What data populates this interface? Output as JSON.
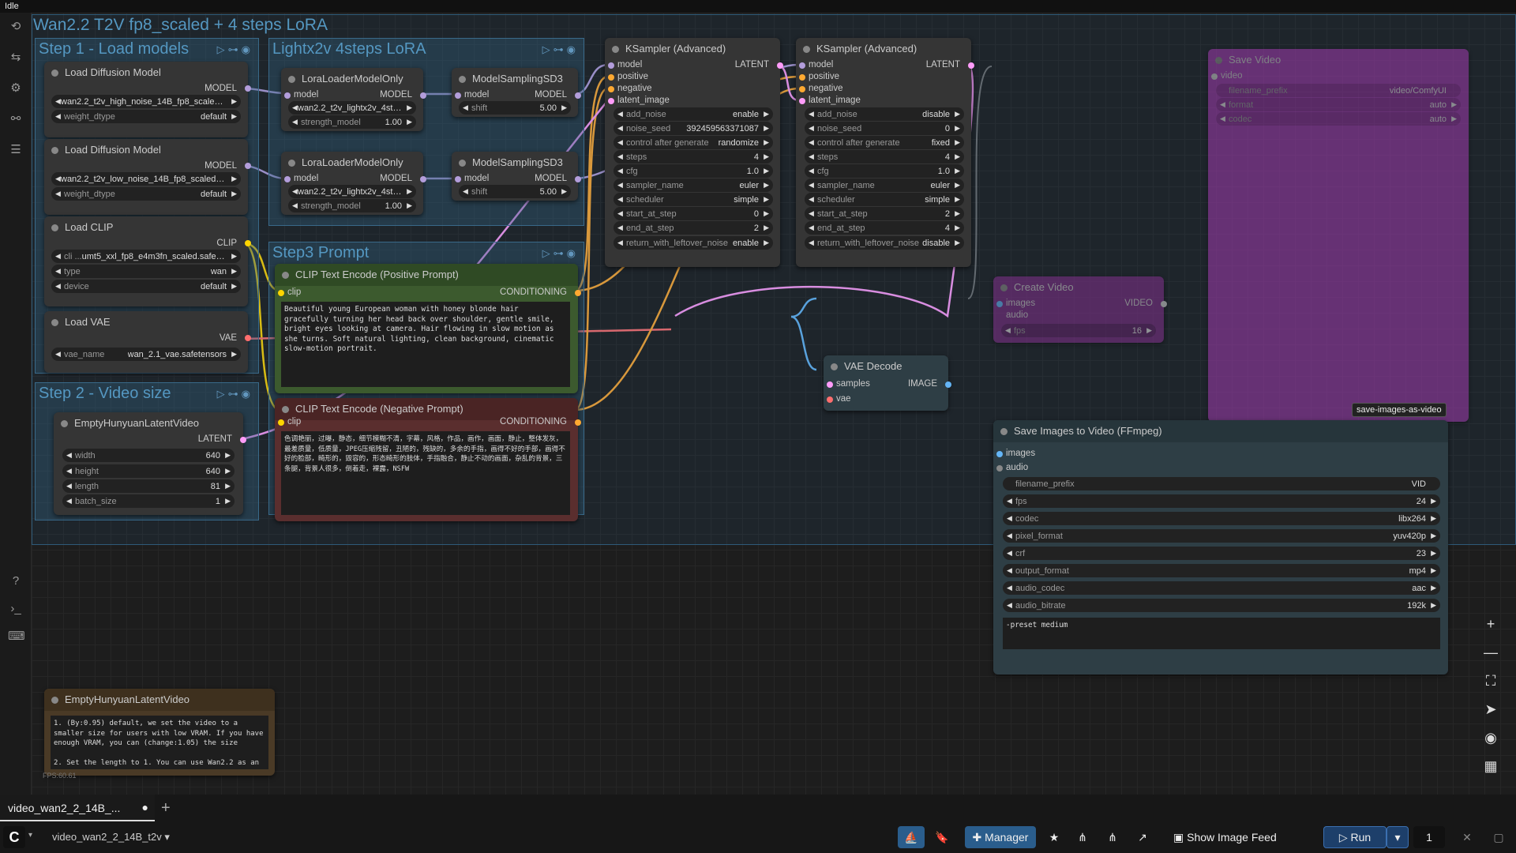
{
  "app": {
    "status": "Idle",
    "fps_readout": "FPS:60.61"
  },
  "workflow_title": "Wan2.2 T2V fp8_scaled +  4 steps LoRA",
  "groups": {
    "step1": "Step 1 - Load models",
    "lightx": "Lightx2v 4steps LoRA",
    "step3": "Step3 Prompt",
    "step2": "Step 2 - Video size"
  },
  "nodes": {
    "diff_high": {
      "title": "Load Diffusion Model",
      "out": "MODEL",
      "unet": "wan2.2_t2v_high_noise_14B_fp8_scaled.saf ...",
      "dtype_label": "weight_dtype",
      "dtype": "default"
    },
    "diff_low": {
      "title": "Load Diffusion Model",
      "out": "MODEL",
      "unet": "wan2.2_t2v_low_noise_14B_fp8_scaled.safet...",
      "dtype_label": "weight_dtype",
      "dtype": "default"
    },
    "clip": {
      "title": "Load CLIP",
      "out": "CLIP",
      "name_label": "cli ...",
      "name": "umt5_xxl_fp8_e4m3fn_scaled.safetensors",
      "type_label": "type",
      "type": "wan",
      "device_label": "device",
      "device": "default"
    },
    "vae": {
      "title": "Load VAE",
      "out": "VAE",
      "name_label": "vae_name",
      "name": "wan_2.1_vae.safetensors"
    },
    "lora1": {
      "title": "LoraLoaderModelOnly",
      "in": "model",
      "out": "MODEL",
      "lora": "wan2.2_t2v_lightx2v_4steps_lora ...",
      "strength_label": "strength_model",
      "strength": "1.00"
    },
    "lora2": {
      "title": "LoraLoaderModelOnly",
      "in": "model",
      "out": "MODEL",
      "lora": "wan2.2_t2v_lightx2v_4steps_lora ...",
      "strength_label": "strength_model",
      "strength": "1.00"
    },
    "msd1": {
      "title": "ModelSamplingSD3",
      "in": "model",
      "out": "MODEL",
      "shift_label": "shift",
      "shift": "5.00"
    },
    "msd2": {
      "title": "ModelSamplingSD3",
      "in": "model",
      "out": "MODEL",
      "shift_label": "shift",
      "shift": "5.00"
    },
    "pos": {
      "title": "CLIP Text Encode (Positive Prompt)",
      "in": "clip",
      "out": "CONDITIONING",
      "text": "Beautiful young European woman with honey blonde hair gracefully turning her head back over shoulder, gentle smile, bright eyes looking at camera. Hair flowing in slow motion as she turns. Soft natural lighting, clean background, cinematic slow-motion portrait."
    },
    "neg": {
      "title": "CLIP Text Encode (Negative Prompt)",
      "in": "clip",
      "out": "CONDITIONING",
      "text": "色调艳丽，过曝，静态，细节模糊不清，字幕，风格，作品，画作，画面，静止，整体发灰，最差质量，低质量，JPEG压缩残留，丑陋的，残缺的，多余的手指，画得不好的手部，画得不好的脸部，畸形的，毁容的，形态畸形的肢体，手指融合，静止不动的画面，杂乱的背景，三条腿，背景人很多，倒着走，裸露，NSFW"
    },
    "latent": {
      "title": "EmptyHunyuanLatentVideo",
      "out": "LATENT",
      "width_label": "width",
      "width": "640",
      "height_label": "height",
      "height": "640",
      "length_label": "length",
      "length": "81",
      "batch_label": "batch_size",
      "batch": "1"
    },
    "ks1": {
      "title": "KSampler (Advanced)",
      "in_model": "model",
      "in_pos": "positive",
      "in_neg": "negative",
      "in_latent": "latent_image",
      "out": "LATENT",
      "widgets": [
        [
          "add_noise",
          "enable"
        ],
        [
          "noise_seed",
          "392459563371087"
        ],
        [
          "control after generate",
          "randomize"
        ],
        [
          "steps",
          "4"
        ],
        [
          "cfg",
          "1.0"
        ],
        [
          "sampler_name",
          "euler"
        ],
        [
          "scheduler",
          "simple"
        ],
        [
          "start_at_step",
          "0"
        ],
        [
          "end_at_step",
          "2"
        ],
        [
          "return_with_leftover_noise",
          "enable"
        ]
      ]
    },
    "ks2": {
      "title": "KSampler (Advanced)",
      "in_model": "model",
      "in_pos": "positive",
      "in_neg": "negative",
      "in_latent": "latent_image",
      "out": "LATENT",
      "widgets": [
        [
          "add_noise",
          "disable"
        ],
        [
          "noise_seed",
          "0"
        ],
        [
          "control after generate",
          "fixed"
        ],
        [
          "steps",
          "4"
        ],
        [
          "cfg",
          "1.0"
        ],
        [
          "sampler_name",
          "euler"
        ],
        [
          "scheduler",
          "simple"
        ],
        [
          "start_at_step",
          "2"
        ],
        [
          "end_at_step",
          "4"
        ],
        [
          "return_with_leftover_noise",
          "disable"
        ]
      ]
    },
    "vaedec": {
      "title": "VAE Decode",
      "in_samples": "samples",
      "in_vae": "vae",
      "out": "IMAGE"
    },
    "savevideo": {
      "title": "Save Video",
      "in": "video",
      "prefix_label": "filename_prefix",
      "prefix": "video/ComfyUI",
      "format_label": "format",
      "format": "auto",
      "codec_label": "codec",
      "codec": "auto"
    },
    "createvideo": {
      "title": "Create Video",
      "in_images": "images",
      "in_audio": "audio",
      "out": "VIDEO",
      "fps_label": "fps",
      "fps": "16"
    },
    "ffmpeg": {
      "title": "Save Images to Video (FFmpeg)",
      "badge": "save-images-as-video",
      "in_images": "images",
      "in_audio": "audio",
      "widgets": [
        [
          "filename_prefix",
          "VID"
        ],
        [
          "fps",
          "24"
        ],
        [
          "codec",
          "libx264"
        ],
        [
          "pixel_format",
          "yuv420p"
        ],
        [
          "crf",
          "23"
        ],
        [
          "output_format",
          "mp4"
        ],
        [
          "audio_codec",
          "aac"
        ],
        [
          "audio_bitrate",
          "192k"
        ]
      ],
      "extra": "-preset medium"
    },
    "note": {
      "title": "EmptyHunyuanLatentVideo",
      "text": "1. (By:0.95) default, we set the video to a smaller size for users with low VRAM. If you have enough VRAM, you can (change:1.05) the size\n\n2. Set the length to 1. You can use Wan2.2 as an image"
    }
  },
  "bottom": {
    "tab": "video_wan2_2_14B_...",
    "workflow": "video_wan2_2_14B_t2v",
    "manager": "Manager",
    "show_feed": "Show Image Feed",
    "run": "Run",
    "count": "1"
  },
  "colors": {
    "model": "#b39ddb",
    "clip": "#ffd500",
    "vae": "#ff6e6e",
    "cond": "#ffa931",
    "latent": "#ff9cf9",
    "image": "#64b5f6"
  }
}
